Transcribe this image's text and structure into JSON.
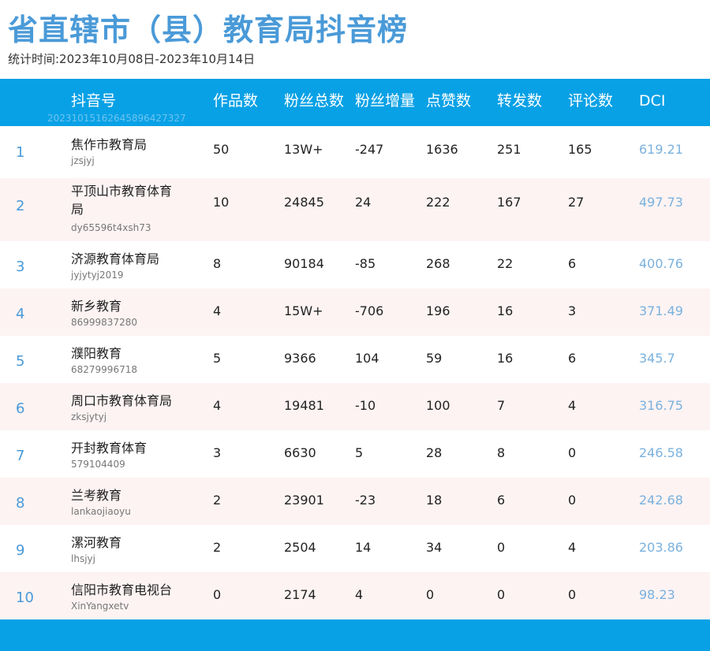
{
  "title": "省直辖市（县）教育局抖音榜",
  "subtitle": "统计时间:2023年10月08日-2023年10月14日",
  "header": {
    "account": "抖音号",
    "works": "作品数",
    "fans_total": "粉丝总数",
    "fans_growth": "粉丝增量",
    "likes": "点赞数",
    "shares": "转发数",
    "comments": "评论数",
    "dci": "DCI",
    "watermark": "20231015162645896427327"
  },
  "rows": [
    {
      "rank": "1",
      "name": "焦作市教育局",
      "account": "jzsjyj",
      "works": "50",
      "fans_total": "13W+",
      "fans_growth": "-247",
      "likes": "1636",
      "shares": "251",
      "comments": "165",
      "dci": "619.21"
    },
    {
      "rank": "2",
      "name": "平顶山市教育体育局",
      "account": "dy65596t4xsh73",
      "works": "10",
      "fans_total": "24845",
      "fans_growth": "24",
      "likes": "222",
      "shares": "167",
      "comments": "27",
      "dci": "497.73"
    },
    {
      "rank": "3",
      "name": "济源教育体育局",
      "account": "jyjytyj2019",
      "works": "8",
      "fans_total": "90184",
      "fans_growth": "-85",
      "likes": "268",
      "shares": "22",
      "comments": "6",
      "dci": "400.76"
    },
    {
      "rank": "4",
      "name": "新乡教育",
      "account": "86999837280",
      "works": "4",
      "fans_total": "15W+",
      "fans_growth": "-706",
      "likes": "196",
      "shares": "16",
      "comments": "3",
      "dci": "371.49"
    },
    {
      "rank": "5",
      "name": "濮阳教育",
      "account": "68279996718",
      "works": "5",
      "fans_total": "9366",
      "fans_growth": "104",
      "likes": "59",
      "shares": "16",
      "comments": "6",
      "dci": "345.7"
    },
    {
      "rank": "6",
      "name": "周口市教育体育局",
      "account": "zksjytyj",
      "works": "4",
      "fans_total": "19481",
      "fans_growth": "-10",
      "likes": "100",
      "shares": "7",
      "comments": "4",
      "dci": "316.75"
    },
    {
      "rank": "7",
      "name": "开封教育体育",
      "account": "579104409",
      "works": "3",
      "fans_total": "6630",
      "fans_growth": "5",
      "likes": "28",
      "shares": "8",
      "comments": "0",
      "dci": "246.58"
    },
    {
      "rank": "8",
      "name": "兰考教育",
      "account": "lankaojiaoyu",
      "works": "2",
      "fans_total": "23901",
      "fans_growth": "-23",
      "likes": "18",
      "shares": "6",
      "comments": "0",
      "dci": "242.68"
    },
    {
      "rank": "9",
      "name": "漯河教育",
      "account": "lhsjyj",
      "works": "2",
      "fans_total": "2504",
      "fans_growth": "14",
      "likes": "34",
      "shares": "0",
      "comments": "4",
      "dci": "203.86"
    },
    {
      "rank": "10",
      "name": "信阳市教育电视台",
      "account": "XinYangxetv",
      "works": "0",
      "fans_total": "2174",
      "fans_growth": "4",
      "likes": "0",
      "shares": "0",
      "comments": "0",
      "dci": "98.23"
    }
  ]
}
